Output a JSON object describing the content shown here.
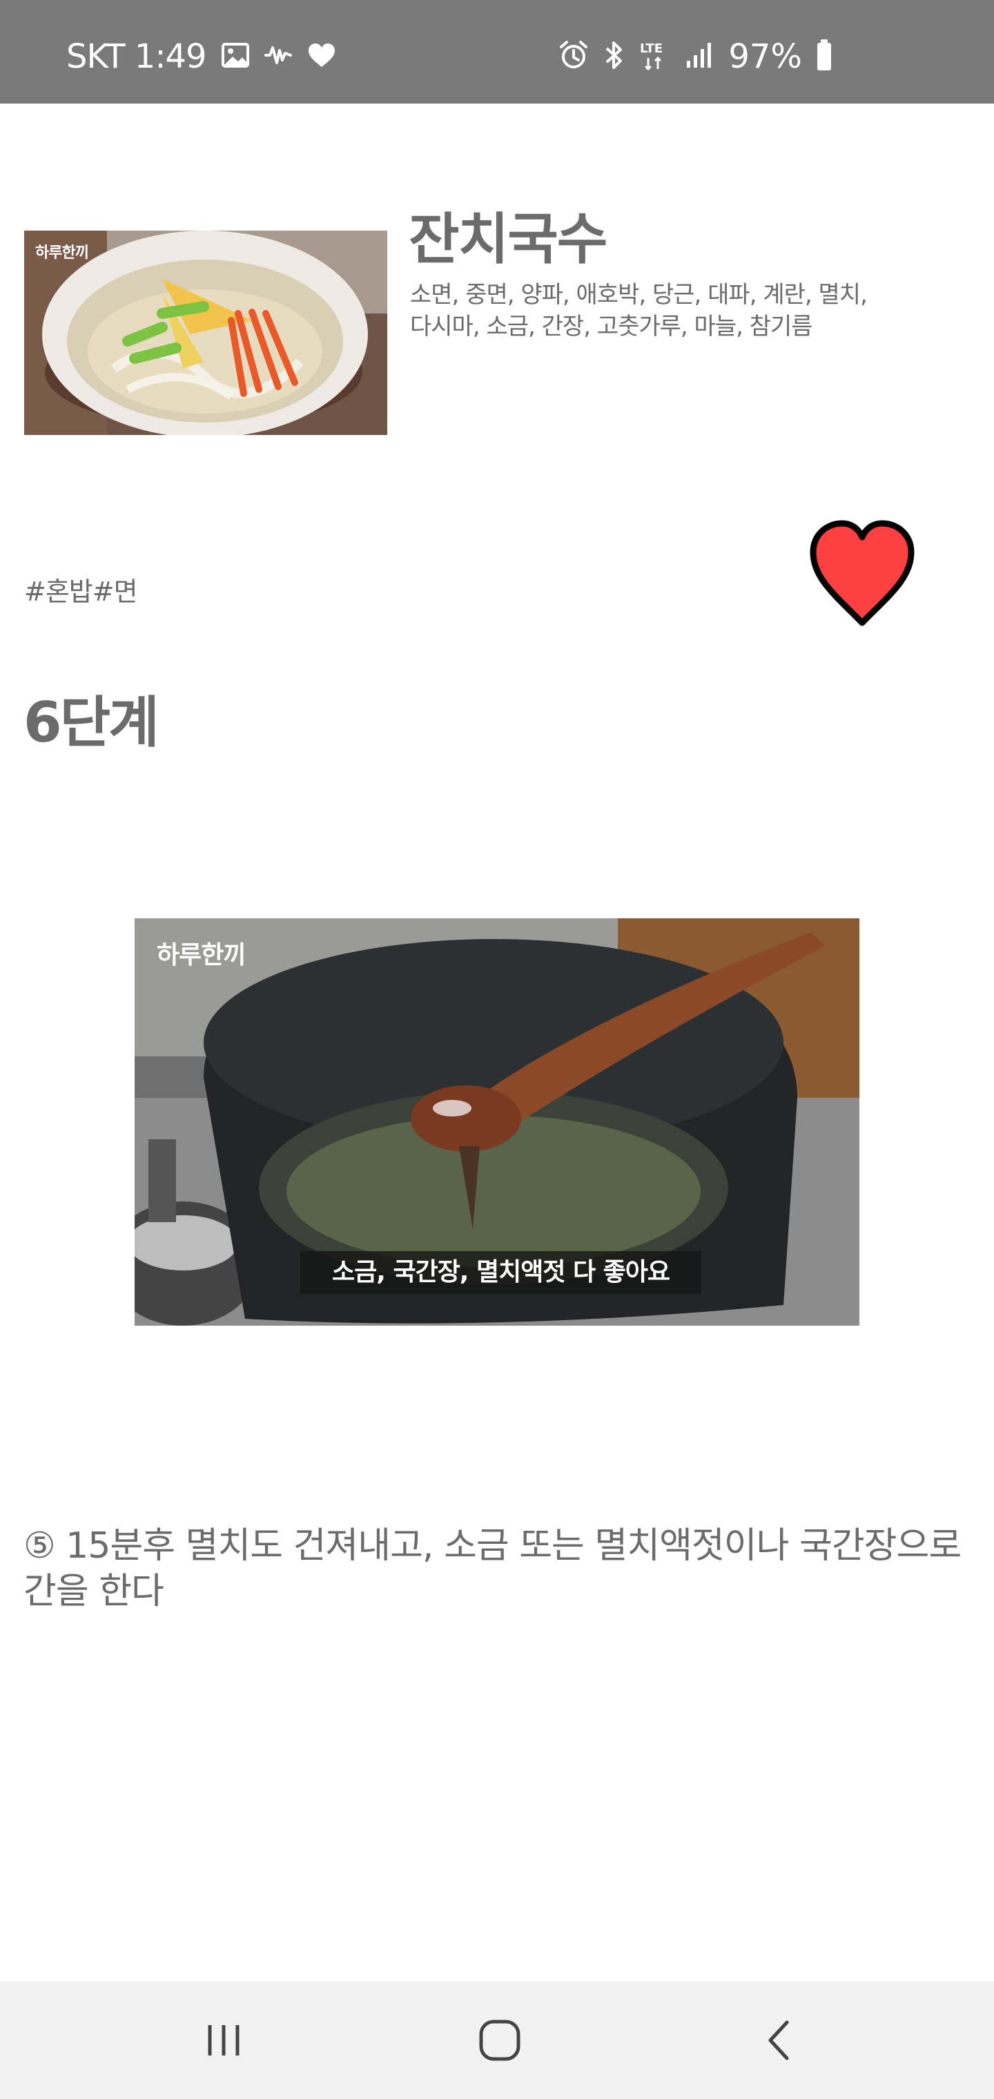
{
  "status_bar": {
    "carrier_time": "SKT 1:49",
    "network": "LTE",
    "battery": "97%",
    "left_icons": [
      "gallery-icon",
      "voicemail-icon",
      "heart-icon"
    ],
    "right_icons": [
      "alarm-icon",
      "bluetooth-icon",
      "lte-icon",
      "signal-icon",
      "battery-icon"
    ]
  },
  "recipe": {
    "thumbnail_brand": "하루한끼",
    "title": "잔치국수",
    "ingredients_line1": "소면, 중면, 양파, 애호박, 당근, 대파, 계란, 멸치,",
    "ingredients_line2": "다시마, 소금, 간장, 고춧가루, 마늘, 참기름",
    "tags": "#혼밥#면",
    "favorite_icon": "heart-icon",
    "favorite_color": "#ff4040"
  },
  "step": {
    "title": "6단계",
    "image_brand": "하루한끼",
    "image_caption": "소금, 국간장, 멸치액젓 다 좋아요",
    "instruction_line1": "⑤ 15분후 멸치도 건져내고, 소금 또는 멸치액젓이나 국간장으로",
    "instruction_line2": "간을 한다"
  },
  "nav_bar": {
    "buttons": [
      "recent-apps",
      "home",
      "back"
    ]
  }
}
